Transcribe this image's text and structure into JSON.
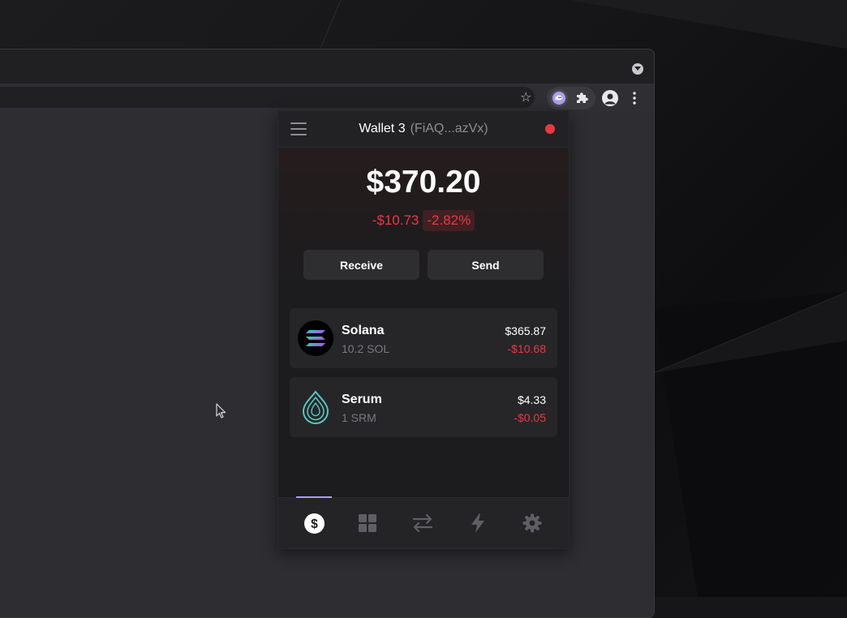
{
  "wallet": {
    "name": "Wallet 3",
    "address": "(FiAQ...azVx)",
    "status_color": "#eb3742",
    "balance": "$370.20",
    "change_value": "-$10.73",
    "change_percent": "-2.82%",
    "actions": {
      "receive": "Receive",
      "send": "Send"
    },
    "tokens": [
      {
        "name": "Solana",
        "amount": "10.2 SOL",
        "value": "$365.87",
        "change": "-$10.68",
        "icon": "solana-logo-icon"
      },
      {
        "name": "Serum",
        "amount": "1 SRM",
        "value": "$4.33",
        "change": "-$0.05",
        "icon": "serum-logo-icon"
      }
    ],
    "nav": [
      {
        "name": "tokens",
        "icon": "dollar-icon",
        "active": true
      },
      {
        "name": "collectibles",
        "icon": "grid-icon",
        "active": false
      },
      {
        "name": "swap",
        "icon": "swap-arrows-icon",
        "active": false
      },
      {
        "name": "activity",
        "icon": "lightning-icon",
        "active": false
      },
      {
        "name": "settings",
        "icon": "gear-icon",
        "active": false
      }
    ]
  },
  "colors": {
    "negative": "#eb3742",
    "accent": "#ab9ff2",
    "panel": "#1c1c1e"
  }
}
